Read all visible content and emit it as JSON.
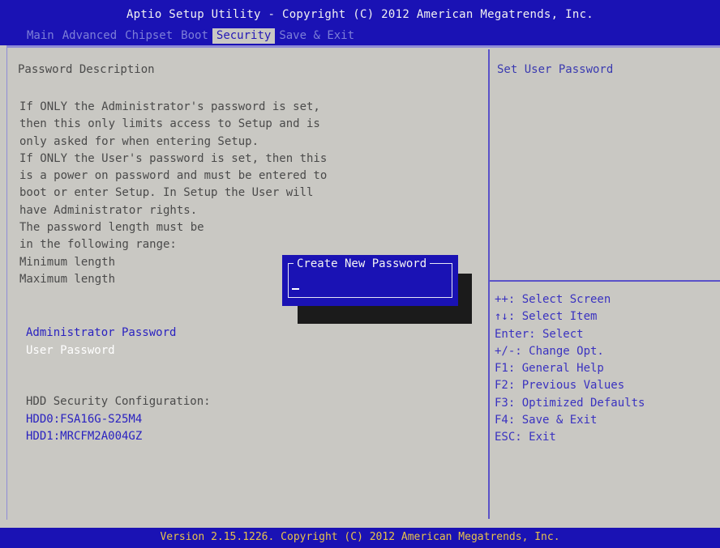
{
  "header": {
    "title": "Aptio Setup Utility - Copyright (C) 2012 American Megatrends, Inc.",
    "tabs": [
      {
        "label": "Main"
      },
      {
        "label": "Advanced"
      },
      {
        "label": "Chipset"
      },
      {
        "label": "Boot"
      },
      {
        "label": "Security"
      },
      {
        "label": "Save & Exit"
      }
    ],
    "active_tab": "Security"
  },
  "main": {
    "description_title": "Password Description",
    "description_lines": [
      "If ONLY the Administrator's password is set,",
      "then this only limits access to Setup and is",
      "only asked for when entering Setup.",
      "If ONLY the User's password is set, then this",
      "is a power on password and must be entered to",
      "boot or enter Setup. In Setup the User will",
      "have Administrator rights.",
      "The password length must be",
      "in the following range:",
      "Minimum length",
      "Maximum length"
    ],
    "admin_password_label": "Administrator Password",
    "user_password_label": "User Password",
    "hdd_security_label": "HDD Security Configuration:",
    "hdd0_label": "HDD0:FSA16G-S25M4",
    "hdd1_label": "HDD1:MRCFM2A004GZ"
  },
  "dialog": {
    "title": "Create New Password",
    "input_value": ""
  },
  "help": {
    "text": "Set User Password",
    "keys": [
      "++: Select Screen",
      "↑↓: Select Item",
      "Enter: Select",
      "+/-: Change Opt.",
      "F1: General Help",
      "F2: Previous Values",
      "F3: Optimized Defaults",
      "F4: Save & Exit",
      "ESC: Exit"
    ]
  },
  "footer": {
    "text": "Version 2.15.1226. Copyright (C) 2012 American Megatrends, Inc."
  },
  "colors": {
    "bar_blue": "#1a12b4",
    "panel_gray": "#c9c8c3",
    "item_blue": "#2a22c0",
    "highlight_white": "#ffffff",
    "footer_yellow": "#e8c24a"
  }
}
